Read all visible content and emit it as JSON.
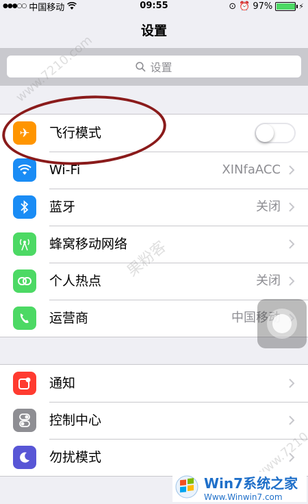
{
  "status_bar": {
    "carrier": "中国移动",
    "time": "09:55",
    "battery": "97%",
    "battery_level": 0.97
  },
  "nav": {
    "title": "设置"
  },
  "search": {
    "placeholder": "设置"
  },
  "group1": [
    {
      "label": "飞行模式",
      "icon": "airplane-icon",
      "color": "#ff9500",
      "toggle": false
    },
    {
      "label": "Wi-Fi",
      "icon": "wifi-icon",
      "color": "#1a8cf5",
      "value": "XINfaACC"
    },
    {
      "label": "蓝牙",
      "icon": "bluetooth-icon",
      "color": "#1a8cf5",
      "value": "关闭"
    },
    {
      "label": "蜂窝移动网络",
      "icon": "cellular-icon",
      "color": "#4cd964",
      "value": ""
    },
    {
      "label": "个人热点",
      "icon": "hotspot-icon",
      "color": "#4cd964",
      "value": "关闭"
    },
    {
      "label": "运营商",
      "icon": "phone-icon",
      "color": "#4cd964",
      "value": "中国移动"
    }
  ],
  "group2": [
    {
      "label": "通知",
      "icon": "notifications-icon",
      "color": "#ff3b30"
    },
    {
      "label": "控制中心",
      "icon": "control-center-icon",
      "color": "#8e8e93"
    },
    {
      "label": "勿扰模式",
      "icon": "moon-icon",
      "color": "#5856d6"
    }
  ],
  "watermarks": [
    "www.7210.com",
    "果粉客",
    "www.7210.com"
  ],
  "logo": {
    "title": "Win7系统之家",
    "url": "Www.Winwin7.com"
  }
}
